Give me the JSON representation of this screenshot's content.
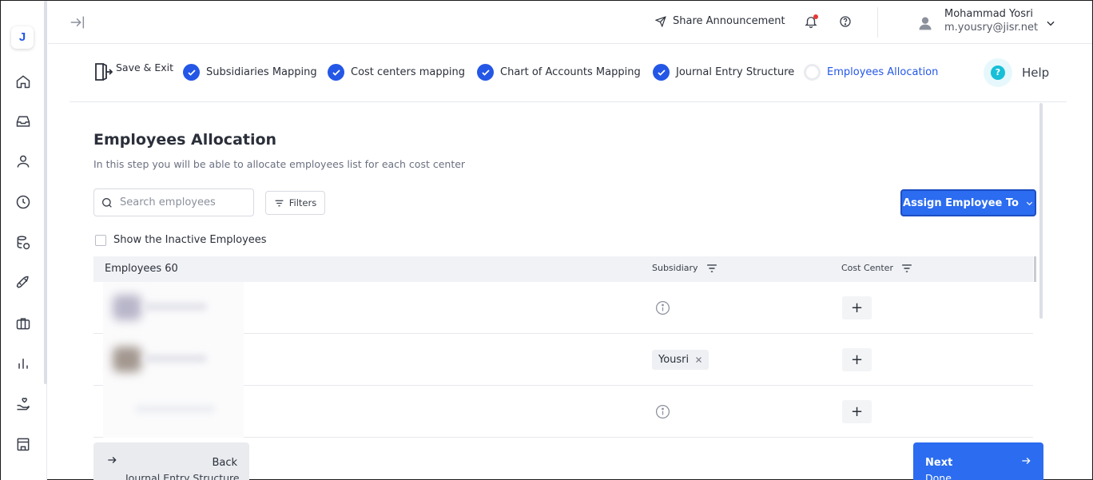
{
  "app": {
    "logo_letter": "J"
  },
  "sidebar": {
    "items": [
      {
        "name": "home-icon"
      },
      {
        "name": "inbox-icon"
      },
      {
        "name": "user-icon"
      },
      {
        "name": "clock-icon"
      },
      {
        "name": "database-icon"
      },
      {
        "name": "rocket-icon"
      },
      {
        "name": "briefcase-icon"
      },
      {
        "name": "chart-bar-icon"
      },
      {
        "name": "hand-heart-icon"
      },
      {
        "name": "building-icon"
      }
    ]
  },
  "header": {
    "share_label": "Share Announcement",
    "user_name": "Mohammad Yosri",
    "user_email": "m.yousry@jisr.net"
  },
  "stepper": {
    "save_exit": "Save & Exit",
    "steps": [
      {
        "label": "Subsidiaries Mapping",
        "status": "done"
      },
      {
        "label": "Cost centers mapping",
        "status": "done"
      },
      {
        "label": "Chart of Accounts Mapping",
        "status": "done"
      },
      {
        "label": "Journal Entry Structure",
        "status": "done"
      },
      {
        "label": "Employees Allocation",
        "status": "active"
      }
    ],
    "help_label": "Help"
  },
  "main": {
    "title": "Employees Allocation",
    "subtitle": "In this step you will be able to allocate employees list for each cost center",
    "search_placeholder": "Search employees",
    "filters_label": "Filters",
    "assign_label": "Assign Employee To",
    "inactive_label": "Show the Inactive Employees"
  },
  "table": {
    "col_employees": "Employees 60",
    "col_subsidiary": "Subsidiary",
    "col_cost_center": "Cost Center",
    "rows": [
      {
        "subsidiary": "",
        "cost_center_action": "+"
      },
      {
        "subsidiary": "Yousri",
        "cost_center_action": "+"
      },
      {
        "subsidiary": "",
        "cost_center_action": "+"
      }
    ]
  },
  "footer": {
    "back_label": "Back",
    "back_sub": "Journal Entry Structure",
    "next_label": "Next",
    "next_sub": "Done"
  },
  "colors": {
    "accent": "#2457e6",
    "primary_button": "#2b6cf0",
    "help_icon": "#17bfd8"
  }
}
